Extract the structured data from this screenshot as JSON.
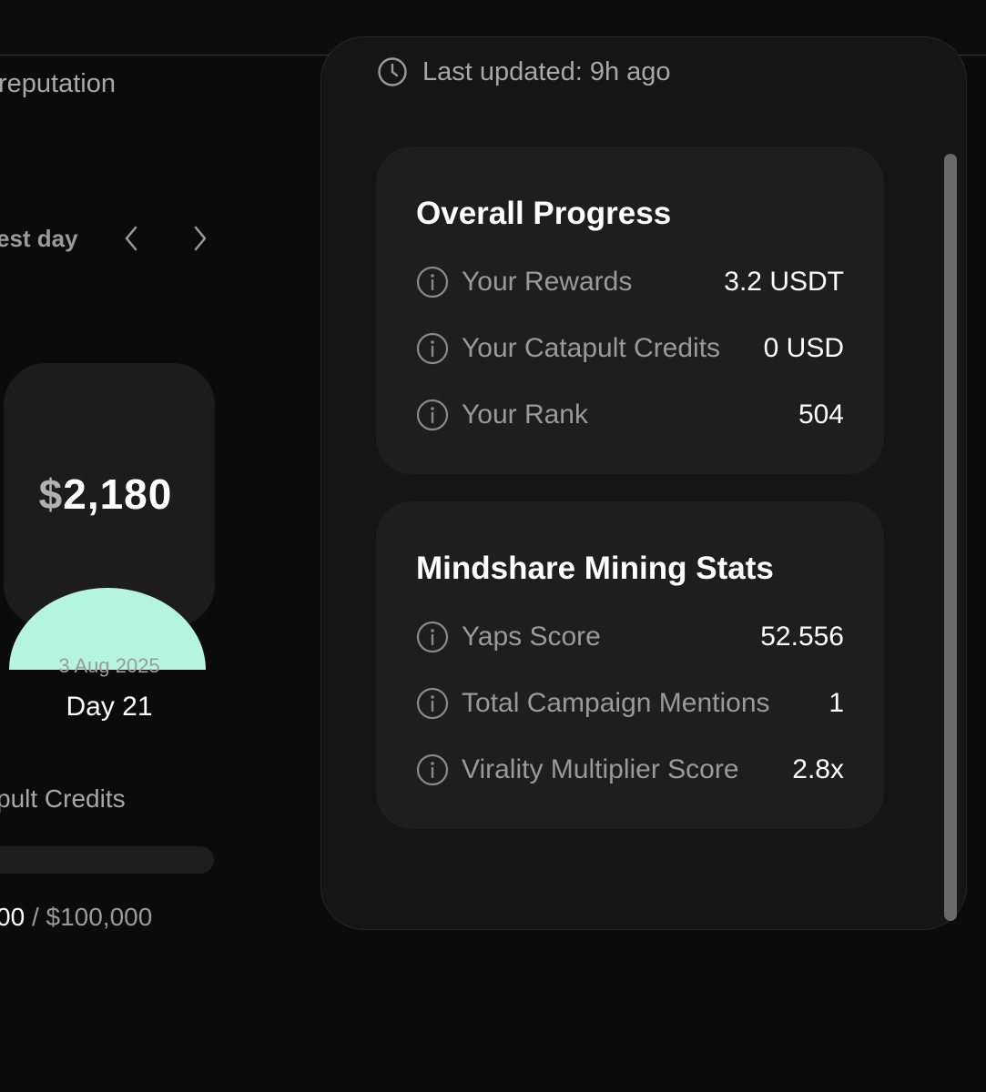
{
  "left": {
    "section_title": "reputation",
    "nav_label": "est day",
    "prize": {
      "currency": "$",
      "amount": "2,180",
      "date": "3 Aug 2025",
      "day": "Day 21",
      "fill_color": "#b5f5e0"
    },
    "credits": {
      "label": "pult Credits",
      "current": "00",
      "separator": "/",
      "total": "$100,000"
    }
  },
  "panel": {
    "last_updated": "Last updated: 9h ago",
    "overall": {
      "title": "Overall Progress",
      "rows": [
        {
          "label": "Your Rewards",
          "value": "3.2 USDT"
        },
        {
          "label": "Your Catapult Credits",
          "value": "0 USD"
        },
        {
          "label": "Your Rank",
          "value": "504"
        }
      ]
    },
    "mindshare": {
      "title": "Mindshare Mining Stats",
      "rows": [
        {
          "label": "Yaps Score",
          "value": "52.556"
        },
        {
          "label": "Total Campaign Mentions",
          "value": "1"
        },
        {
          "label": "Virality Multiplier Score",
          "value": "2.8x"
        }
      ]
    }
  },
  "icons": {
    "info": "info-circle-icon",
    "clock": "clock-icon",
    "prev": "chevron-left-icon",
    "next": "chevron-right-icon"
  }
}
